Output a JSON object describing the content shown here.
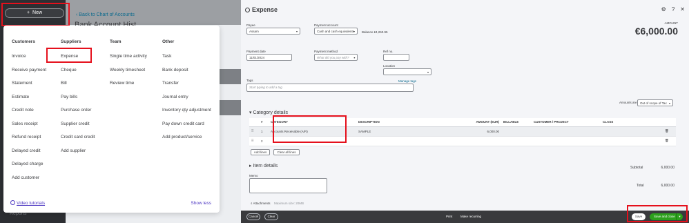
{
  "left": {
    "new_button": "New",
    "back_link": "Back to Chart of Accounts",
    "page_title": "Bank Account Hist",
    "reports": "Reports",
    "menu": {
      "columns": [
        {
          "head": "Customers",
          "items": [
            "Invoice",
            "Receive payment",
            "Statement",
            "Estimate",
            "Credit note",
            "Sales receipt",
            "Refund receipt",
            "Delayed credit",
            "Delayed charge",
            "Add customer"
          ]
        },
        {
          "head": "Suppliers",
          "items": [
            "Expense",
            "Cheque",
            "Bill",
            "Pay bills",
            "Purchase order",
            "Supplier credit",
            "Credit card credit",
            "Add supplier"
          ]
        },
        {
          "head": "Team",
          "items": [
            "Single time activity",
            "Weekly timesheet",
            "Review time"
          ]
        },
        {
          "head": "Other",
          "items": [
            "Task",
            "Bank deposit",
            "Transfer",
            "Journal entry",
            "Inventory qty adjustment",
            "Pay down credit card",
            "Add product/service"
          ]
        }
      ],
      "video_tutorials": "Video tutorials",
      "show_less": "Show less"
    }
  },
  "expense": {
    "title": "Expense",
    "payee_label": "Payee",
    "payee_value": "Assam",
    "payment_account_label": "Payment account",
    "payment_account_value": "Cash and cash equivalents",
    "balance": "Balance €4,260.95",
    "amount_label": "AMOUNT",
    "amount_value": "€6,000.00",
    "payment_date_label": "Payment date",
    "payment_date_value": "11/01/2024",
    "payment_method_label": "Payment method",
    "payment_method_placeholder": "What did you pay with?",
    "ref_label": "Ref no.",
    "location_label": "Location",
    "tags_label": "Tags",
    "tags_placeholder": "Start typing to add a tag",
    "manage_tags": "Manage tags",
    "amounts_are_label": "Amounts are",
    "amounts_are_value": "Out of scope of Tax",
    "category_details": "Category details",
    "table_headers": [
      "#",
      "CATEGORY",
      "DESCRIPTION",
      "AMOUNT (EUR)",
      "BILLABLE",
      "CUSTOMER / PROJECT",
      "CLASS"
    ],
    "rows": [
      {
        "num": "1",
        "category": "Accounts Receivable (A/R)",
        "description": "SAMPLE",
        "amount": "6,000.00"
      },
      {
        "num": "2",
        "category": "",
        "description": "",
        "amount": ""
      }
    ],
    "add_lines": "Add lines",
    "clear_all_lines": "Clear all lines",
    "item_details": "Item details",
    "subtotal_label": "Subtotal",
    "subtotal_value": "6,000.00",
    "total_label": "Total",
    "total_value": "6,000.00",
    "memo_label": "Memo",
    "attachments_label": "Attachments",
    "attachments_hint": "Maximum size: 20MB",
    "footer": {
      "cancel": "Cancel",
      "clear": "Clear",
      "print": "Print",
      "make_recurring": "Make recurring",
      "save": "Save",
      "save_and_close": "Save and close"
    }
  }
}
